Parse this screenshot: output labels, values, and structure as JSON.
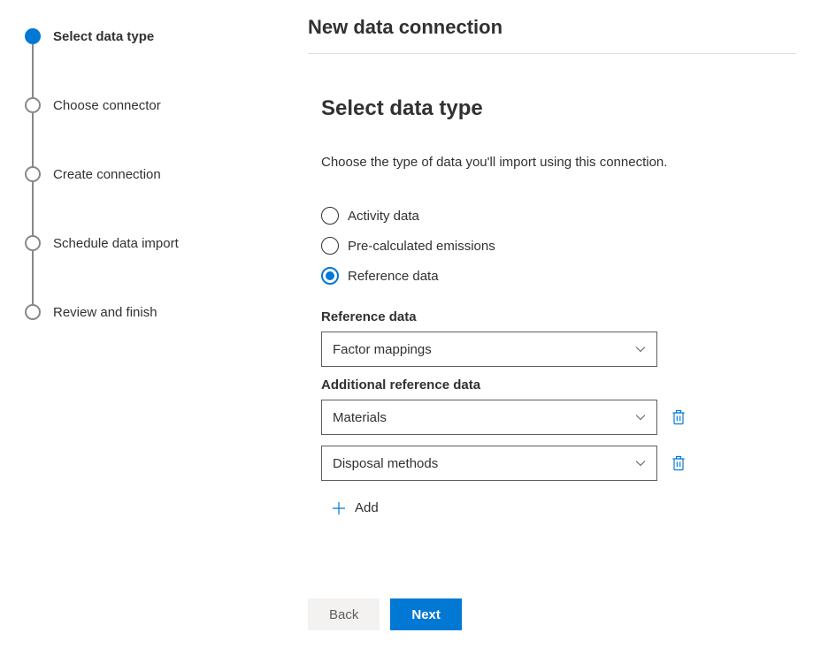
{
  "header": {
    "title": "New data connection"
  },
  "steps": [
    {
      "label": "Select data type",
      "active": true
    },
    {
      "label": "Choose connector",
      "active": false
    },
    {
      "label": "Create connection",
      "active": false
    },
    {
      "label": "Schedule data import",
      "active": false
    },
    {
      "label": "Review and finish",
      "active": false
    }
  ],
  "section": {
    "heading": "Select data type",
    "description": "Choose the type of data you'll import using this connection."
  },
  "radios": [
    {
      "label": "Activity data",
      "selected": false
    },
    {
      "label": "Pre-calculated emissions",
      "selected": false
    },
    {
      "label": "Reference data",
      "selected": true
    }
  ],
  "referenceData": {
    "label": "Reference data",
    "value": "Factor mappings"
  },
  "additional": {
    "label": "Additional reference data",
    "items": [
      {
        "value": "Materials"
      },
      {
        "value": "Disposal methods"
      }
    ]
  },
  "addLabel": "Add",
  "footer": {
    "back": "Back",
    "next": "Next"
  },
  "colors": {
    "primary": "#0078d4",
    "text": "#323130",
    "border": "#605e5c"
  }
}
